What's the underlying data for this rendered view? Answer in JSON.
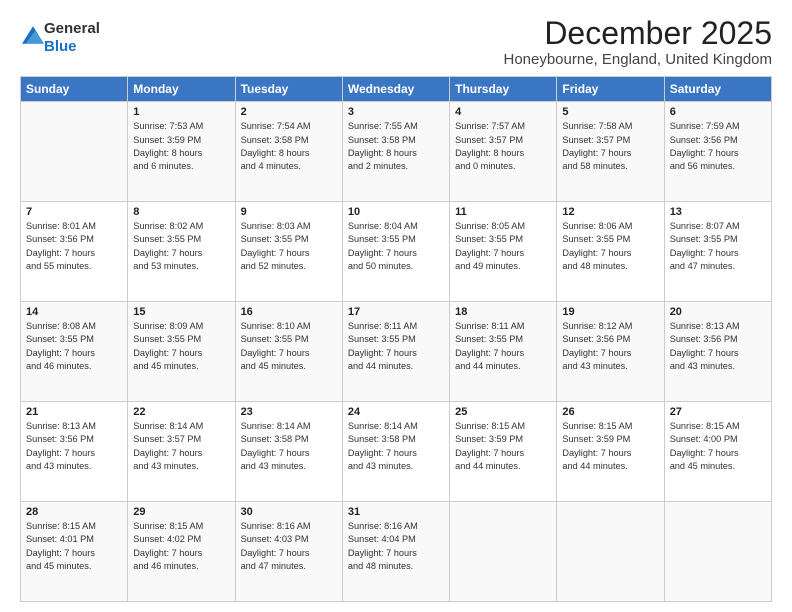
{
  "header": {
    "logo_general": "General",
    "logo_blue": "Blue",
    "month_title": "December 2025",
    "location": "Honeybourne, England, United Kingdom"
  },
  "days_of_week": [
    "Sunday",
    "Monday",
    "Tuesday",
    "Wednesday",
    "Thursday",
    "Friday",
    "Saturday"
  ],
  "weeks": [
    [
      {
        "day": "",
        "text": ""
      },
      {
        "day": "1",
        "text": "Sunrise: 7:53 AM\nSunset: 3:59 PM\nDaylight: 8 hours\nand 6 minutes."
      },
      {
        "day": "2",
        "text": "Sunrise: 7:54 AM\nSunset: 3:58 PM\nDaylight: 8 hours\nand 4 minutes."
      },
      {
        "day": "3",
        "text": "Sunrise: 7:55 AM\nSunset: 3:58 PM\nDaylight: 8 hours\nand 2 minutes."
      },
      {
        "day": "4",
        "text": "Sunrise: 7:57 AM\nSunset: 3:57 PM\nDaylight: 8 hours\nand 0 minutes."
      },
      {
        "day": "5",
        "text": "Sunrise: 7:58 AM\nSunset: 3:57 PM\nDaylight: 7 hours\nand 58 minutes."
      },
      {
        "day": "6",
        "text": "Sunrise: 7:59 AM\nSunset: 3:56 PM\nDaylight: 7 hours\nand 56 minutes."
      }
    ],
    [
      {
        "day": "7",
        "text": "Sunrise: 8:01 AM\nSunset: 3:56 PM\nDaylight: 7 hours\nand 55 minutes."
      },
      {
        "day": "8",
        "text": "Sunrise: 8:02 AM\nSunset: 3:55 PM\nDaylight: 7 hours\nand 53 minutes."
      },
      {
        "day": "9",
        "text": "Sunrise: 8:03 AM\nSunset: 3:55 PM\nDaylight: 7 hours\nand 52 minutes."
      },
      {
        "day": "10",
        "text": "Sunrise: 8:04 AM\nSunset: 3:55 PM\nDaylight: 7 hours\nand 50 minutes."
      },
      {
        "day": "11",
        "text": "Sunrise: 8:05 AM\nSunset: 3:55 PM\nDaylight: 7 hours\nand 49 minutes."
      },
      {
        "day": "12",
        "text": "Sunrise: 8:06 AM\nSunset: 3:55 PM\nDaylight: 7 hours\nand 48 minutes."
      },
      {
        "day": "13",
        "text": "Sunrise: 8:07 AM\nSunset: 3:55 PM\nDaylight: 7 hours\nand 47 minutes."
      }
    ],
    [
      {
        "day": "14",
        "text": "Sunrise: 8:08 AM\nSunset: 3:55 PM\nDaylight: 7 hours\nand 46 minutes."
      },
      {
        "day": "15",
        "text": "Sunrise: 8:09 AM\nSunset: 3:55 PM\nDaylight: 7 hours\nand 45 minutes."
      },
      {
        "day": "16",
        "text": "Sunrise: 8:10 AM\nSunset: 3:55 PM\nDaylight: 7 hours\nand 45 minutes."
      },
      {
        "day": "17",
        "text": "Sunrise: 8:11 AM\nSunset: 3:55 PM\nDaylight: 7 hours\nand 44 minutes."
      },
      {
        "day": "18",
        "text": "Sunrise: 8:11 AM\nSunset: 3:55 PM\nDaylight: 7 hours\nand 44 minutes."
      },
      {
        "day": "19",
        "text": "Sunrise: 8:12 AM\nSunset: 3:56 PM\nDaylight: 7 hours\nand 43 minutes."
      },
      {
        "day": "20",
        "text": "Sunrise: 8:13 AM\nSunset: 3:56 PM\nDaylight: 7 hours\nand 43 minutes."
      }
    ],
    [
      {
        "day": "21",
        "text": "Sunrise: 8:13 AM\nSunset: 3:56 PM\nDaylight: 7 hours\nand 43 minutes."
      },
      {
        "day": "22",
        "text": "Sunrise: 8:14 AM\nSunset: 3:57 PM\nDaylight: 7 hours\nand 43 minutes."
      },
      {
        "day": "23",
        "text": "Sunrise: 8:14 AM\nSunset: 3:58 PM\nDaylight: 7 hours\nand 43 minutes."
      },
      {
        "day": "24",
        "text": "Sunrise: 8:14 AM\nSunset: 3:58 PM\nDaylight: 7 hours\nand 43 minutes."
      },
      {
        "day": "25",
        "text": "Sunrise: 8:15 AM\nSunset: 3:59 PM\nDaylight: 7 hours\nand 44 minutes."
      },
      {
        "day": "26",
        "text": "Sunrise: 8:15 AM\nSunset: 3:59 PM\nDaylight: 7 hours\nand 44 minutes."
      },
      {
        "day": "27",
        "text": "Sunrise: 8:15 AM\nSunset: 4:00 PM\nDaylight: 7 hours\nand 45 minutes."
      }
    ],
    [
      {
        "day": "28",
        "text": "Sunrise: 8:15 AM\nSunset: 4:01 PM\nDaylight: 7 hours\nand 45 minutes."
      },
      {
        "day": "29",
        "text": "Sunrise: 8:15 AM\nSunset: 4:02 PM\nDaylight: 7 hours\nand 46 minutes."
      },
      {
        "day": "30",
        "text": "Sunrise: 8:16 AM\nSunset: 4:03 PM\nDaylight: 7 hours\nand 47 minutes."
      },
      {
        "day": "31",
        "text": "Sunrise: 8:16 AM\nSunset: 4:04 PM\nDaylight: 7 hours\nand 48 minutes."
      },
      {
        "day": "",
        "text": ""
      },
      {
        "day": "",
        "text": ""
      },
      {
        "day": "",
        "text": ""
      }
    ]
  ]
}
